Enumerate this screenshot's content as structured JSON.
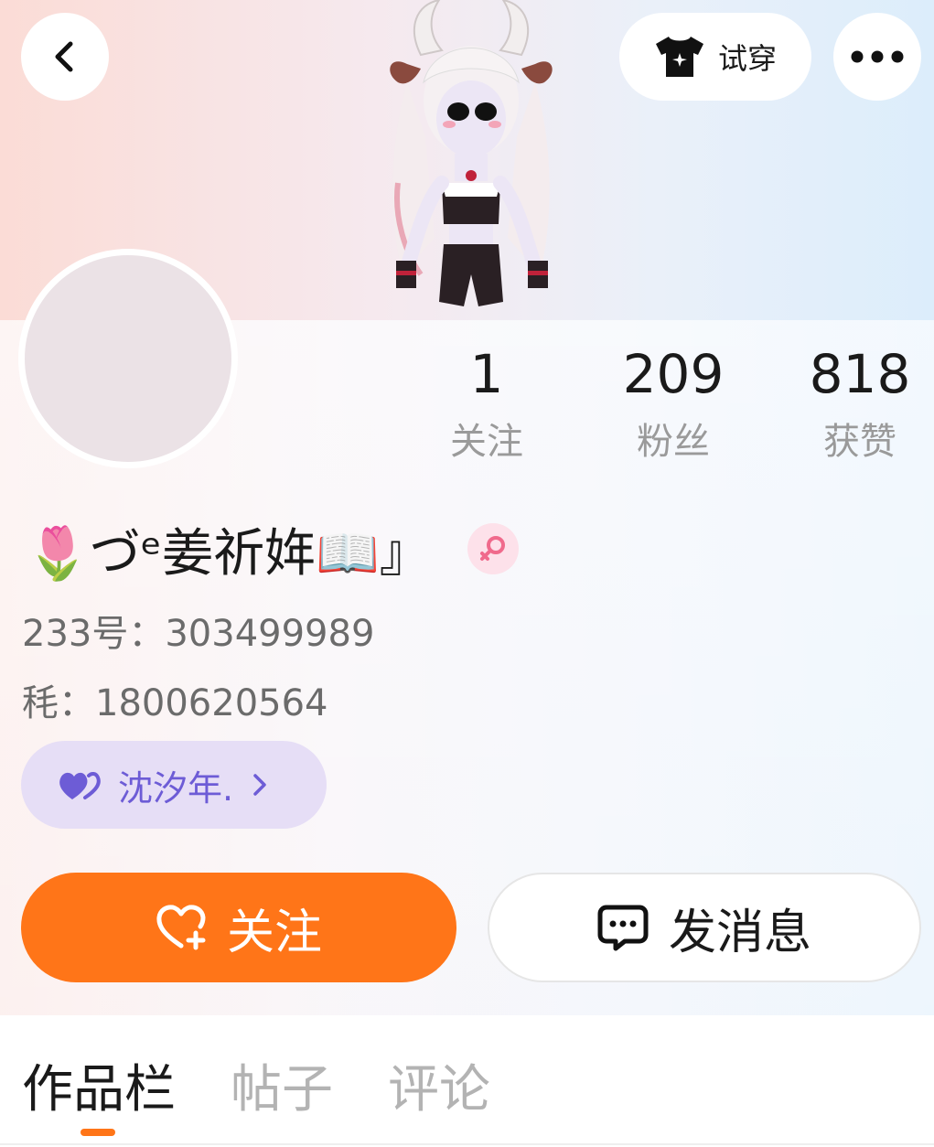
{
  "header": {
    "tryon_label": "试穿"
  },
  "stats": [
    {
      "value": "1",
      "label": "关注"
    },
    {
      "value": "209",
      "label": "粉丝"
    },
    {
      "value": "818",
      "label": "获赞"
    }
  ],
  "profile": {
    "display_name": "🌷づᵉ姜祈姩📖』",
    "id_line": "233号：303499989",
    "nickname_line": "秏：1800620564",
    "relation_name": "沈汐年."
  },
  "actions": {
    "follow_label": "关注",
    "message_label": "发消息"
  },
  "tabs": [
    {
      "label": "作品栏",
      "active": true
    },
    {
      "label": "帖子",
      "active": false
    },
    {
      "label": "评论",
      "active": false
    }
  ],
  "colors": {
    "accent": "#ff7518",
    "relation_chip": "#e6def6",
    "relation_text": "#6d5cd6",
    "gender_badge": "#fde1ea"
  },
  "icons": {
    "back": "chevron-left-icon",
    "tryon": "shirt-icon",
    "more": "more-horizontal-icon",
    "gender": "female-icon",
    "relation": "double-heart-icon",
    "follow": "heart-plus-icon",
    "message": "chat-bubble-icon"
  }
}
